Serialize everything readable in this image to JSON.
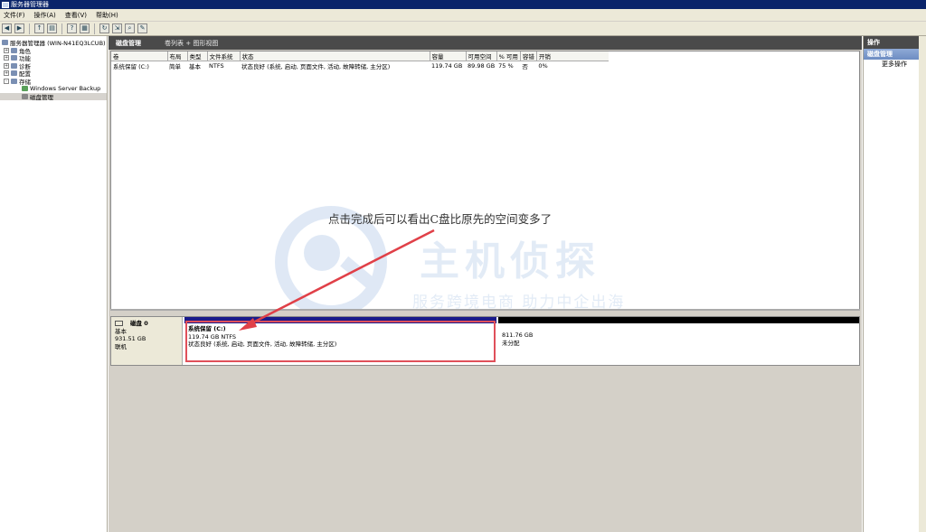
{
  "window": {
    "title": "服务器管理器"
  },
  "menu": [
    "文件(F)",
    "操作(A)",
    "查看(V)",
    "帮助(H)"
  ],
  "toolbar_icons": [
    "back-icon",
    "forward-icon",
    "up-icon",
    "show-hide-tree-icon",
    "help-icon",
    "properties-icon",
    "refresh-icon",
    "export-icon",
    "find-icon",
    "wizard-icon"
  ],
  "nav": {
    "items": [
      {
        "label": "服务器管理器 (WIN-N41EQ3LCUB)",
        "level": 0,
        "exp": ""
      },
      {
        "label": "角色",
        "level": 1,
        "exp": "+"
      },
      {
        "label": "功能",
        "level": 1,
        "exp": "+"
      },
      {
        "label": "诊断",
        "level": 1,
        "exp": "+"
      },
      {
        "label": "配置",
        "level": 1,
        "exp": "+"
      },
      {
        "label": "存储",
        "level": 1,
        "exp": "-"
      },
      {
        "label": "Windows Server Backup",
        "level": 2,
        "exp": ""
      },
      {
        "label": "磁盘管理",
        "level": 2,
        "exp": ""
      }
    ]
  },
  "panel": {
    "title": "磁盘管理",
    "subtitle": "卷列表 + 图形视图"
  },
  "volume_table": {
    "headers": [
      "卷",
      "布局",
      "类型",
      "文件系统",
      "状态",
      "容量",
      "可用空间",
      "% 可用",
      "容错",
      "开销"
    ],
    "rows": [
      [
        "系统保留 (C:)",
        "简单",
        "基本",
        "NTFS",
        "状态良好 (系统, 启动, 页面文件, 活动, 故障转储, 主分区)",
        "119.74 GB",
        "89.98 GB",
        "75 %",
        "否",
        "0%"
      ]
    ]
  },
  "annotation": {
    "text": "点击完成后可以看出C盘比原先的空间变多了",
    "color": "#e04048"
  },
  "watermark": {
    "text": "主机侦探",
    "slogan": "服务跨境电商 助力中企出海"
  },
  "disk": {
    "name": "磁盘 0",
    "type": "基本",
    "size": "931.51 GB",
    "status": "联机",
    "partitions": [
      {
        "name": "系统保留  (C:)",
        "size": "119.74 GB NTFS",
        "status": "状态良好 (系统, 启动, 页面文件, 活动, 故障转储, 主分区)"
      },
      {
        "name": "",
        "size": "811.76 GB",
        "status": "未分配"
      }
    ]
  },
  "actions": {
    "header": "操作",
    "section": "磁盘管理",
    "more": "更多操作"
  }
}
